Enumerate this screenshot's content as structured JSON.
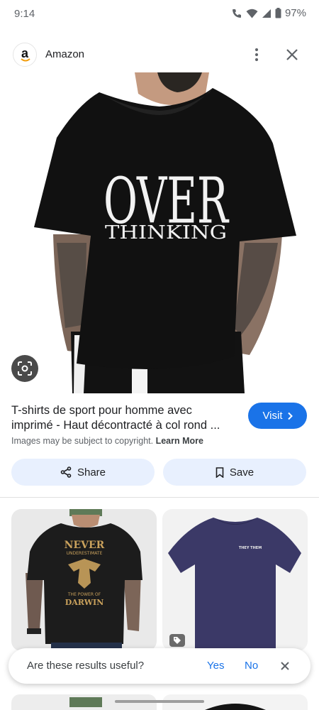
{
  "status_bar": {
    "time": "9:14",
    "battery": "97%"
  },
  "header": {
    "source_name": "Amazon",
    "logo_letter": "a"
  },
  "hero": {
    "graphic_text_line1": "OVER",
    "graphic_text_line2": "THINKING",
    "shirt_color": "#111111"
  },
  "result": {
    "title": "T-shirts de sport pour homme avec imprimé - Haut décontracté à col rond ...",
    "visit_label": "Visit",
    "copyright_text": "Images may be subject to copyright.",
    "learn_more": "Learn More"
  },
  "actions": {
    "share_label": "Share",
    "save_label": "Save"
  },
  "related": [
    {
      "graphic_lines": [
        "NEVER",
        "UNDERESTIMATE",
        "THE POWER OF",
        "DARWIN"
      ],
      "shirt_color": "#1c1c1c"
    },
    {
      "graphic_lines": [
        "THEY THEM"
      ],
      "shirt_color": "#3b3967"
    }
  ],
  "feedback": {
    "question": "Are these results useful?",
    "yes": "Yes",
    "no": "No"
  },
  "colors": {
    "accent": "#1a73e8",
    "chip_bg": "#e8f0fe"
  }
}
